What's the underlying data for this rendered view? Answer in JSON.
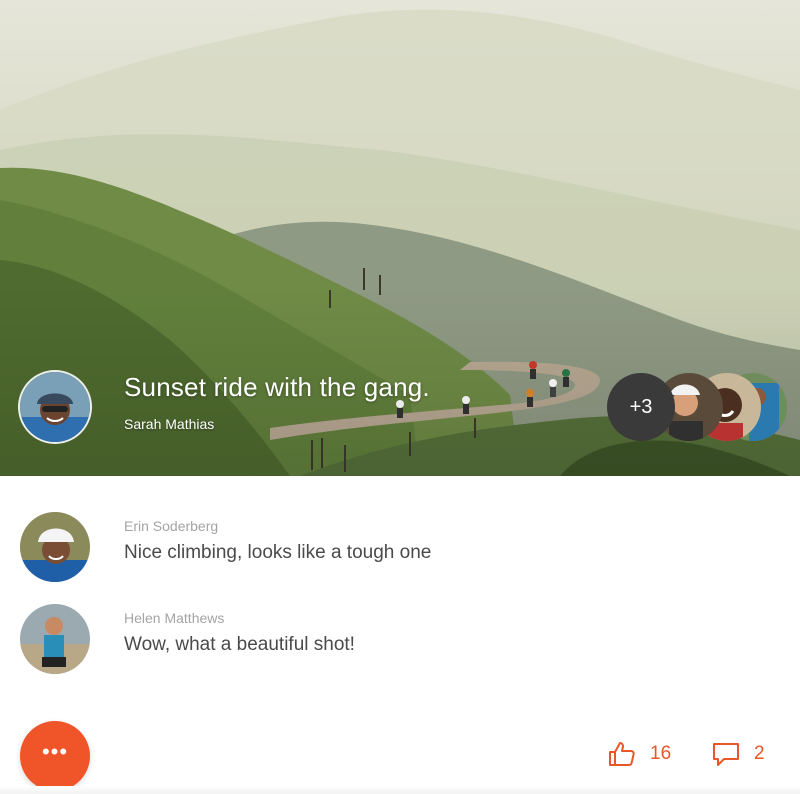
{
  "post": {
    "title": "Sunset ride with the gang.",
    "author": "Sarah Mathias",
    "extra_participants": "+3"
  },
  "comments": [
    {
      "author": "Erin Soderberg",
      "text": "Nice climbing, looks like a tough one"
    },
    {
      "author": "Helen Matthews",
      "text": "Wow, what a beautiful shot!"
    }
  ],
  "actions": {
    "menu_glyph": "•••",
    "likes": "16",
    "replies": "2",
    "like_icon": "thumbs-up-icon",
    "reply_icon": "speech-bubble-icon",
    "menu_icon": "more-dots-icon"
  },
  "colors": {
    "accent": "#f0552a",
    "stat": "#e8572a",
    "comment_name": "#a4a4a4",
    "comment_text": "#4a4a4a",
    "count_badge": "#3a3a3a"
  }
}
